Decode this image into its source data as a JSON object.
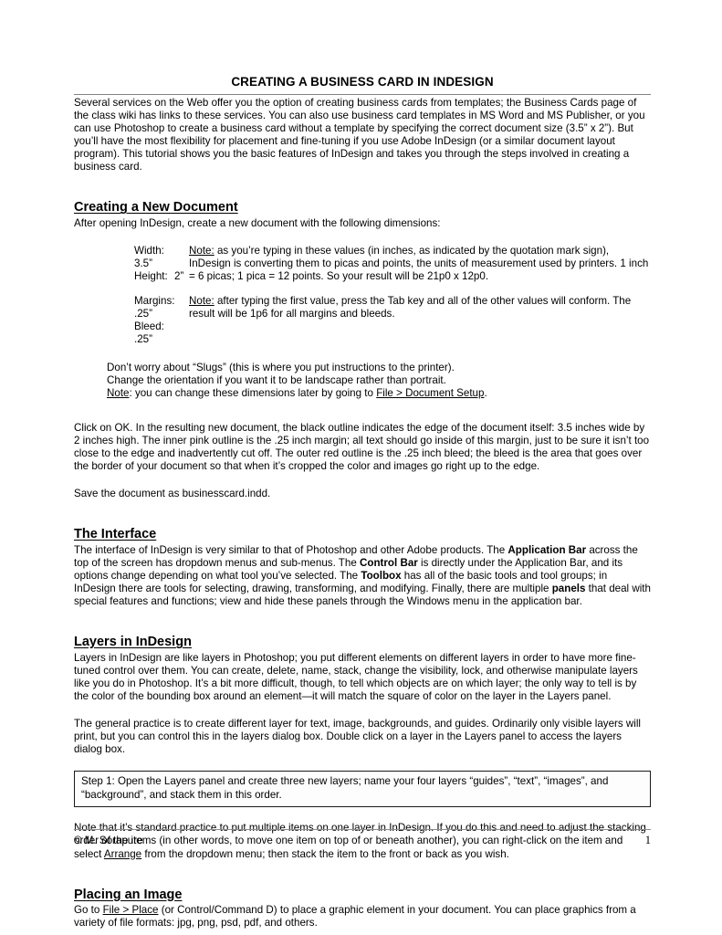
{
  "document": {
    "title": "CREATING A BUSINESS CARD IN INDESIGN",
    "intro": "Several services on the Web offer you the option of creating business cards from templates; the Business Cards page of the class wiki has links to these services. You can also use business card templates in MS Word and MS Publisher, or you can use Photoshop to create a business card without a template by specifying the correct document size (3.5” x 2”). But you’ll have the most flexibility for placement and fine-tuning if you use Adobe InDesign (or a similar document layout program). This tutorial shows you the basic features of InDesign and takes you through the steps involved in creating a business card."
  },
  "sections": {
    "new_document": {
      "heading": "Creating a New Document",
      "lead": "After opening InDesign, create a new document with the following dimensions:",
      "specs": [
        {
          "labels": [
            {
              "name": "Width:",
              "value": "3.5”"
            },
            {
              "name": "Height:",
              "value": "2”"
            }
          ],
          "note_label": "Note:",
          "note_text": " as you’re typing in these values (in inches, as indicated by the quotation mark sign), InDesign is converting them to picas and points, the units of measurement used by printers. 1 inch = 6 picas; 1 pica = 12 points. So your result will be 21p0 x 12p0."
        },
        {
          "labels": [
            {
              "name": "Margins:",
              "value": ".25”"
            },
            {
              "name": "Bleed:",
              "value": ".25”"
            }
          ],
          "note_label": "Note:",
          "note_text": " after typing the first value, press the Tab key and all of the other values will conform. The result will be 1p6 for all margins and bleeds."
        }
      ],
      "tips": {
        "line1": "Don’t worry about “Slugs” (this is where you put instructions to the printer).",
        "line2": "Change the orientation if you want it to be landscape rather than portrait.",
        "line3_label": "Note",
        "line3_mid": ": you can change these dimensions later by going to ",
        "line3_link": "File > Document Setup",
        "line3_end": "."
      },
      "ok_paragraph": "Click on OK. In the resulting new document, the black outline indicates the edge of the document itself: 3.5 inches wide by 2 inches high. The inner pink outline is the .25 inch margin; all text should go inside of this margin, just to be sure it isn’t too close to the edge and inadvertently cut off. The outer red outline is the .25 inch bleed; the bleed is the area that goes over the border of your document so that when it’s cropped the color and images go right up to the edge.",
      "save_paragraph": "Save the document as businesscard.indd."
    },
    "interface": {
      "heading": "The Interface",
      "p1_a": "The interface of InDesign is very similar to that of Photoshop and other Adobe products. The ",
      "p1_b1": "Application Bar",
      "p1_b": " across the top of the screen has dropdown menus and sub-menus. The ",
      "p1_b2": "Control Bar",
      "p1_c": " is directly under the Application Bar, and its options change depending on what tool you’ve selected. The ",
      "p1_b3": "Toolbox",
      "p1_d": " has all of the basic tools and tool groups; in InDesign there are tools for selecting, drawing, transforming, and modifying. Finally, there are multiple ",
      "p1_b4": "panels",
      "p1_e": " that deal with special features and functions; view and hide these panels through the Windows menu in the application bar."
    },
    "layers": {
      "heading": "Layers in InDesign",
      "p1": "Layers in InDesign are like layers in Photoshop; you put different elements on different layers in order to have more fine-tuned control over them. You can create, delete, name, stack, change the visibility, lock, and otherwise manipulate layers like you do in Photoshop. It’s a bit more difficult, though, to tell which objects are on which layer; the only way to tell is by the color of the bounding box around an element—it will match the square of color on the layer in the Layers panel.",
      "p2": "The general practice is to create different layer for text, image, backgrounds, and guides. Ordinarily only visible layers will print, but you can control this in the layers dialog box. Double click on a layer in the Layers panel to access the layers dialog box.",
      "step_box": "Step 1:  Open the Layers panel and create three new layers; name your four layers “guides”, “text”, “images”, and “background”, and stack them in this order.",
      "p3_a": "Note that it’s standard practice to put multiple items on one layer in InDesign. If you do this and need to adjust the stacking order of the items (in other words, to move one item on top of or beneath another), you can right-click on the item and select ",
      "p3_link": "Arrange",
      "p3_b": " from the dropdown menu; then stack the item to the front or back as you wish."
    },
    "placing_image": {
      "heading": "Placing an Image",
      "p1_a": "Go to ",
      "p1_link": "File > Place",
      "p1_b": " (or Control/Command D) to place a graphic element in your document. You can place graphics from a variety of file formats: jpg, png, psd, pdf, and others."
    }
  },
  "footer": {
    "copyright": "© M. Sorapure",
    "page_number": "1"
  }
}
